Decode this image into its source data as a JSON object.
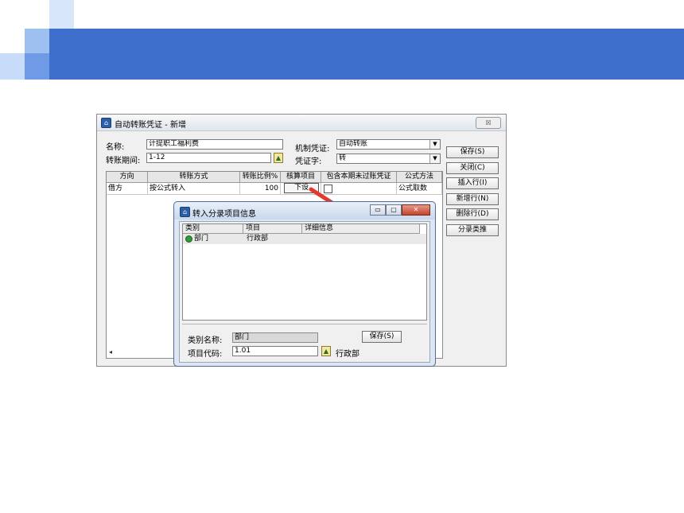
{
  "theme": {
    "banner_color": "#3e6fcd",
    "accent_light": "#9ec0f0",
    "accent_mid": "#6f9be6"
  },
  "window": {
    "title": "自动转账凭证 - 新增",
    "close_label": "☒",
    "name_label": "名称:",
    "name_value": "计提职工福利费",
    "period_label": "转账期间:",
    "period_value": "1-12",
    "voucher_type_label": "机制凭证:",
    "voucher_type_value": "自动转账",
    "voucher_word_label": "凭证字:",
    "voucher_word_value": "转"
  },
  "buttons": {
    "save": "保存(S)",
    "close": "关闭(C)",
    "insert_row": "插入行(I)",
    "new_row": "新增行(N)",
    "delete_row": "删除行(D)",
    "entry_analogy": "分录类推"
  },
  "grid": {
    "headers": [
      "方向",
      "转账方式",
      "转账比例%",
      "核算项目",
      "包含本期未过账凭证",
      "公式方法"
    ],
    "row": {
      "direction": "借方",
      "method": "按公式转入",
      "ratio": "100",
      "item_button": "下设",
      "formula": "公式取数"
    }
  },
  "dialog": {
    "title": "转入分录项目信息",
    "headers": [
      "类别",
      "项目",
      "详细信息"
    ],
    "row": {
      "category": "部门",
      "item": "行政部"
    },
    "category_name_label": "类别名称:",
    "category_name_value": "部门",
    "save_label": "保存(S)",
    "item_code_label": "项目代码:",
    "item_code_value": "1.01",
    "item_code_name": "行政部"
  }
}
